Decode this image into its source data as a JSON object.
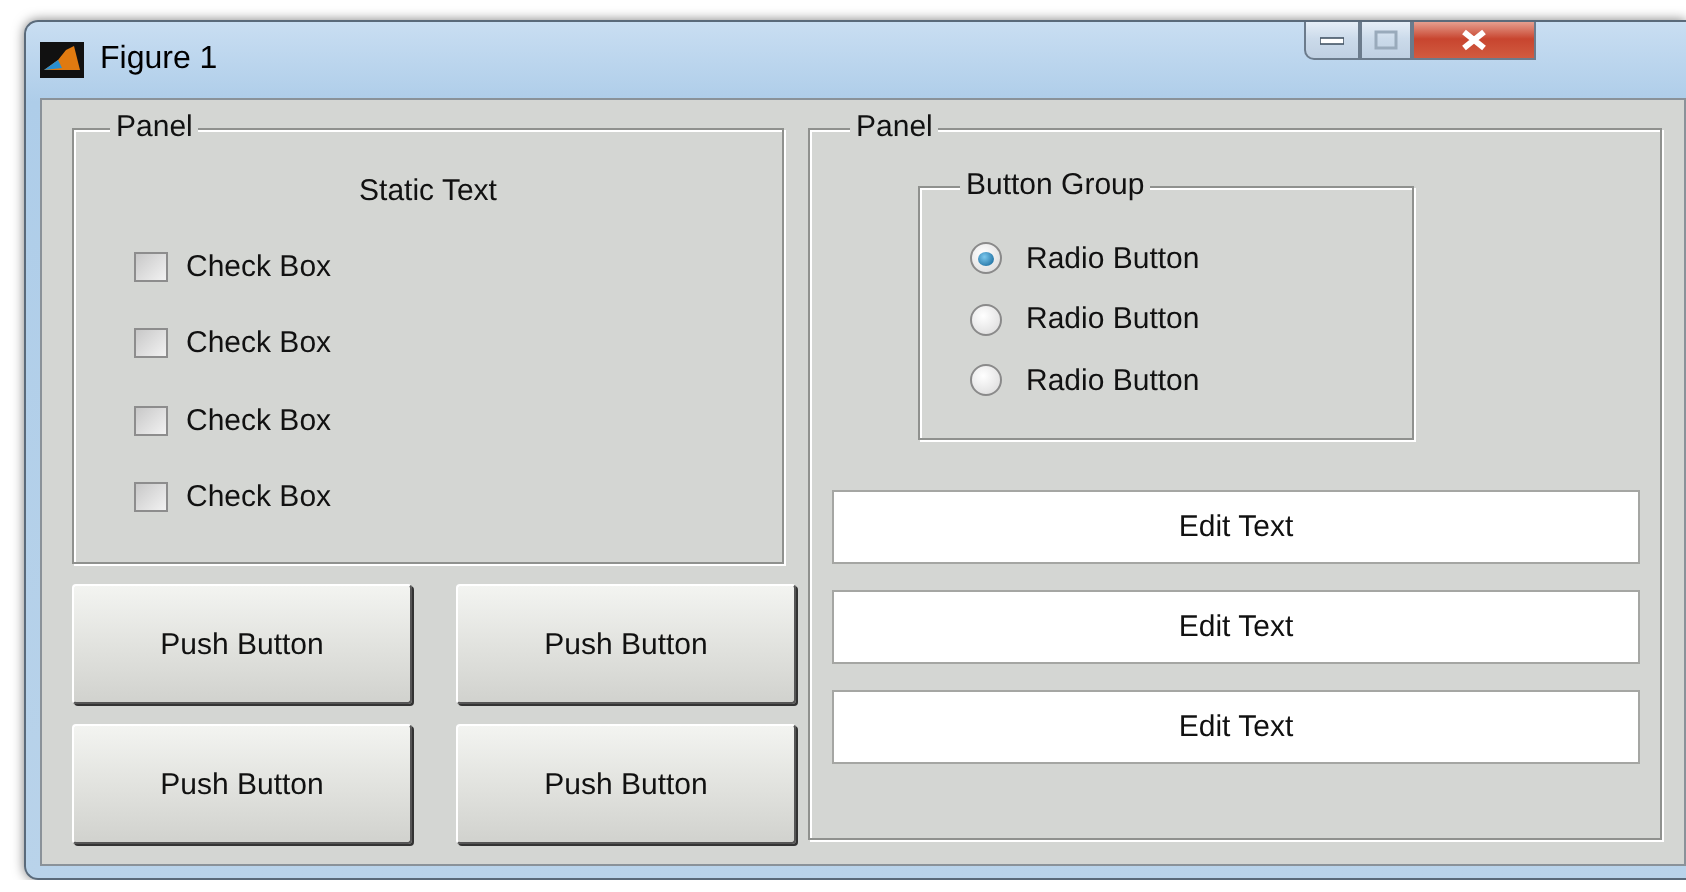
{
  "window": {
    "title": "Figure 1"
  },
  "left_panel": {
    "title": "Panel",
    "static_text": "Static Text",
    "checkboxes": [
      {
        "label": "Check Box",
        "checked": false
      },
      {
        "label": "Check Box",
        "checked": false
      },
      {
        "label": "Check Box",
        "checked": false
      },
      {
        "label": "Check Box",
        "checked": false
      }
    ]
  },
  "push_buttons": [
    "Push Button",
    "Push Button",
    "Push Button",
    "Push Button"
  ],
  "right_panel": {
    "title": "Panel",
    "button_group": {
      "title": "Button Group",
      "radios": [
        {
          "label": "Radio Button",
          "selected": true
        },
        {
          "label": "Radio Button",
          "selected": false
        },
        {
          "label": "Radio Button",
          "selected": false
        }
      ]
    },
    "edit_texts": [
      "Edit Text",
      "Edit Text",
      "Edit Text"
    ]
  }
}
